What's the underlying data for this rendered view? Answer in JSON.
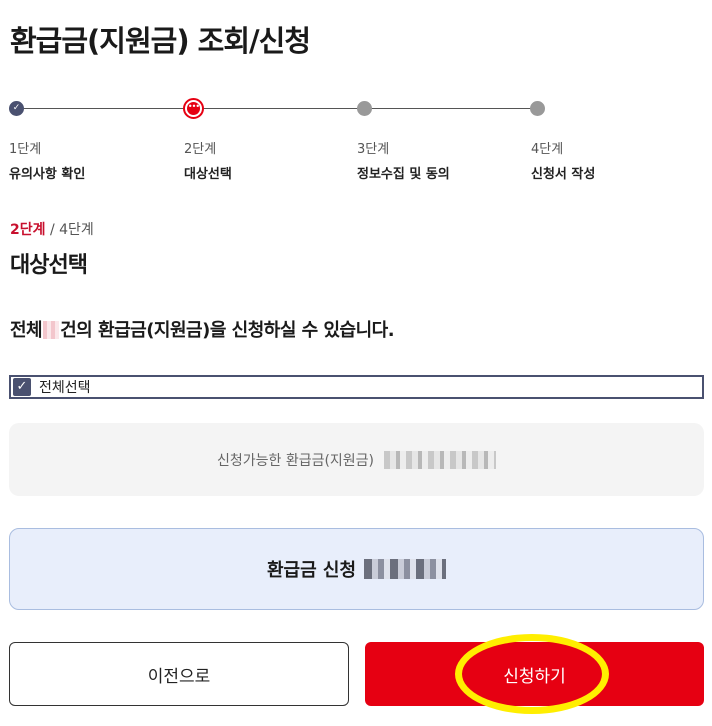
{
  "page": {
    "title": "환급금(지원금) 조회/신청"
  },
  "stepper": {
    "steps": [
      {
        "num": "1단계",
        "name": "유의사항 확인",
        "state": "done"
      },
      {
        "num": "2단계",
        "name": "대상선택",
        "state": "current"
      },
      {
        "num": "3단계",
        "name": "정보수집 및 동의",
        "state": "pending"
      },
      {
        "num": "4단계",
        "name": "신청서 작성",
        "state": "pending"
      }
    ]
  },
  "stage": {
    "current": "2단계",
    "separator": " / ",
    "total": "4단계",
    "section_title": "대상선택"
  },
  "summary": {
    "prefix": "전체",
    "suffix": "건의 환급금(지원금)을 신청하실 수 있습니다."
  },
  "select_all": {
    "label": "전체선택",
    "checked": true
  },
  "info": {
    "available_label": "신청가능한 환급금(지원금)"
  },
  "apply_summary": {
    "label": "환급금 신청"
  },
  "buttons": {
    "prev_label": "이전으로",
    "apply_label": "신청하기"
  },
  "colors": {
    "accent_red": "#e60012",
    "navy": "#4a5170",
    "highlight": "#ffee00",
    "apply_box_bg": "#e8eefb"
  }
}
